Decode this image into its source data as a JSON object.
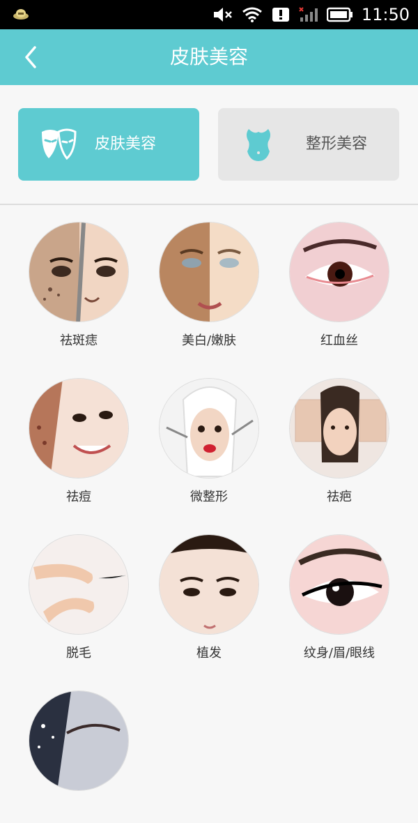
{
  "status_bar": {
    "time": "11:50"
  },
  "header": {
    "title": "皮肤美容"
  },
  "tabs": [
    {
      "label": "皮肤美容",
      "active": true,
      "icon": "mask-icon"
    },
    {
      "label": "整形美容",
      "active": false,
      "icon": "torso-icon"
    }
  ],
  "categories": [
    {
      "label": "祛斑痣",
      "icon": "face-zipper-image"
    },
    {
      "label": "美白/嫩肤",
      "icon": "face-split-image"
    },
    {
      "label": "红血丝",
      "icon": "eye-red-image"
    },
    {
      "label": "祛痘",
      "icon": "face-acne-image"
    },
    {
      "label": "微整形",
      "icon": "face-surgery-image"
    },
    {
      "label": "祛疤",
      "icon": "face-scar-image"
    },
    {
      "label": "脱毛",
      "icon": "legs-image"
    },
    {
      "label": "植发",
      "icon": "hairline-image"
    },
    {
      "label": "纹身/眉/眼线",
      "icon": "eye-liner-image"
    },
    {
      "label": "",
      "icon": "eye-art-image"
    }
  ],
  "colors": {
    "accent": "#5ecbd1"
  }
}
